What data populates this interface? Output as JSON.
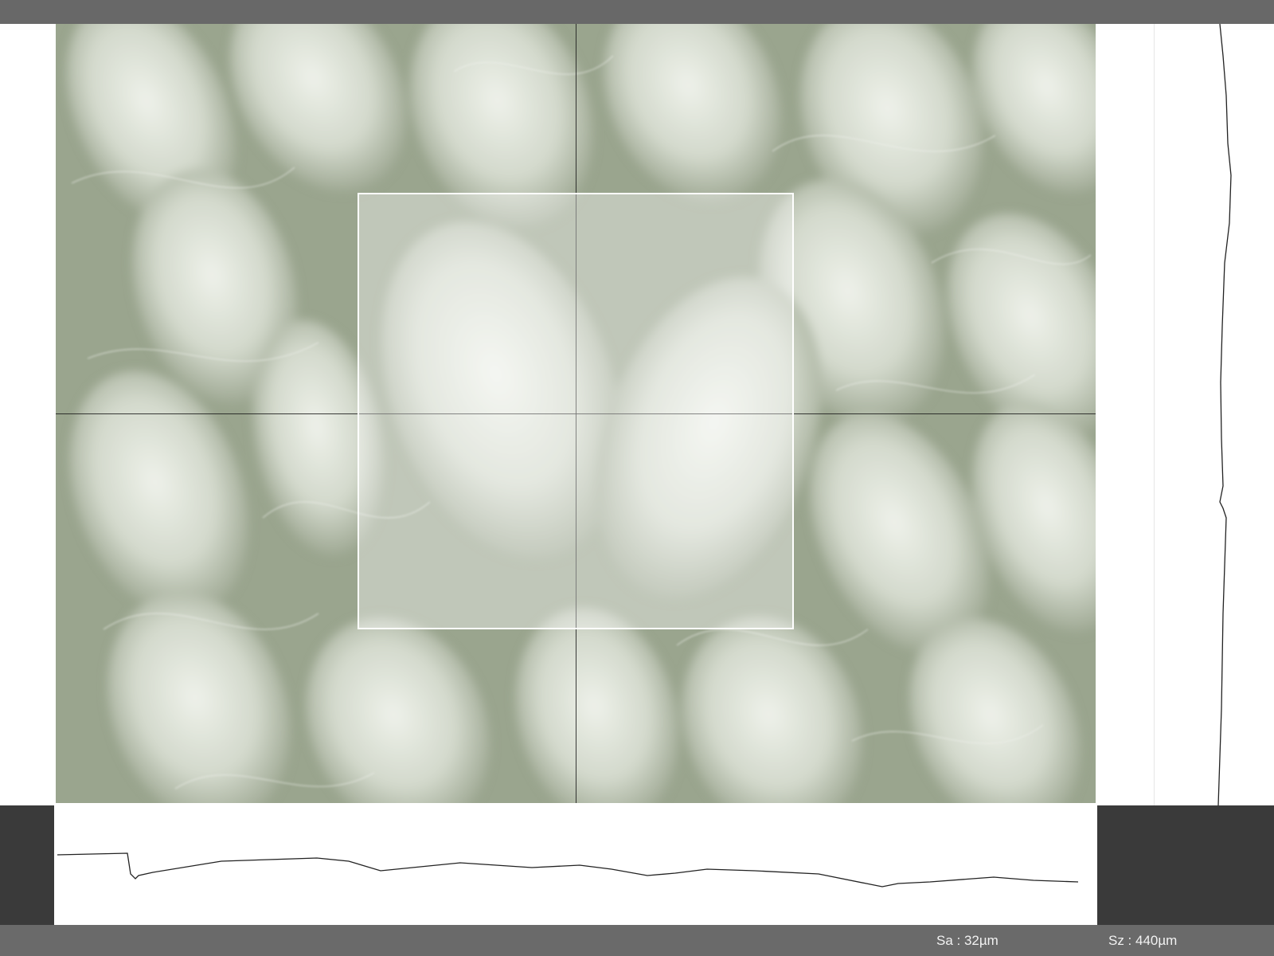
{
  "viewer": {
    "image_description_icon": "microscope-fabric-image",
    "colors": {
      "toolbar": "#686868",
      "statusbar": "#6a6a6a",
      "dark_panel": "#3a3a3a",
      "roi_border": "#ffffff",
      "crosshair": "#1b1b1b",
      "profile_line": "#222222"
    }
  },
  "status": {
    "sa_label": "Sa : ",
    "sa_value": "32µm",
    "sz_label": "Sz : ",
    "sz_value": "440µm"
  }
}
